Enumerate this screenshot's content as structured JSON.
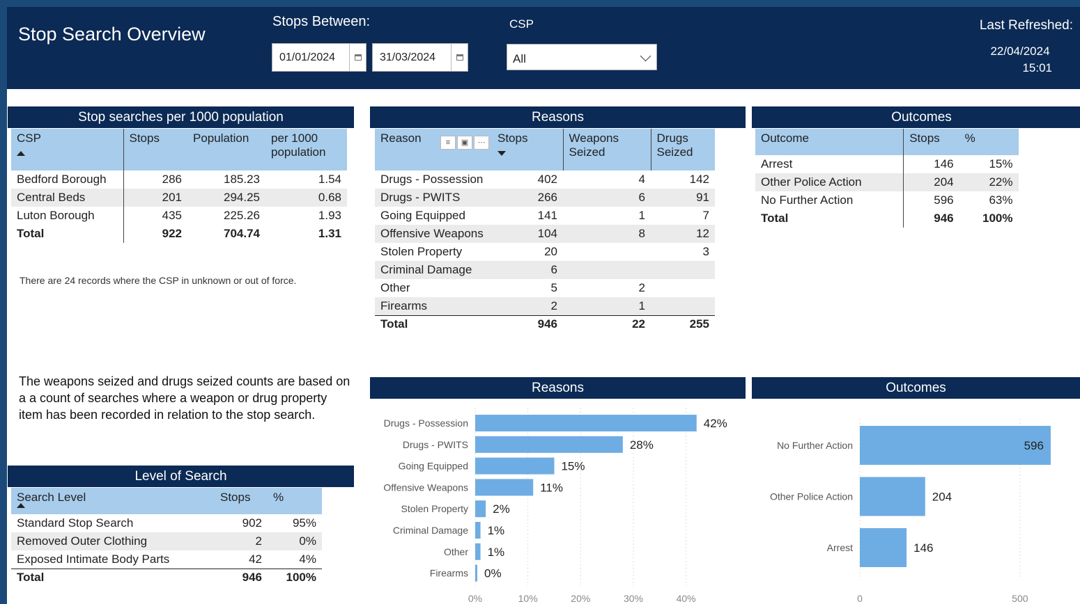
{
  "header": {
    "title": "Stop Search Overview",
    "stops_between_label": "Stops Between:",
    "date_from": "01/01/2024",
    "date_to": "31/03/2024",
    "csp_label": "CSP",
    "csp_value": "All",
    "last_refreshed_label": "Last Refreshed:",
    "last_refreshed_date": "22/04/2024",
    "last_refreshed_time": "15:01"
  },
  "population_table": {
    "title": "Stop searches per 1000 population",
    "headers": [
      "CSP",
      "Stops",
      "Population",
      "per 1000 population"
    ],
    "rows": [
      [
        "Bedford Borough",
        "286",
        "185.23",
        "1.54"
      ],
      [
        "Central Beds",
        "201",
        "294.25",
        "0.68"
      ],
      [
        "Luton Borough",
        "435",
        "225.26",
        "1.93"
      ]
    ],
    "total": [
      "Total",
      "922",
      "704.74",
      "1.31"
    ],
    "note": "There are 24 records where the CSP in unknown or out of force."
  },
  "weapons_note": "The weapons seized and drugs seized counts are based on a a count of searches where a weapon or drug property item has been recorded in relation to the stop search.",
  "reasons_table": {
    "title": "Reasons",
    "headers": [
      "Reason",
      "Stops",
      "Weapons Seized",
      "Drugs Seized"
    ],
    "rows": [
      [
        "Drugs - Possession",
        "402",
        "4",
        "142"
      ],
      [
        "Drugs - PWITS",
        "266",
        "6",
        "91"
      ],
      [
        "Going Equipped",
        "141",
        "1",
        "7"
      ],
      [
        "Offensive Weapons",
        "104",
        "8",
        "12"
      ],
      [
        "Stolen Property",
        "20",
        "",
        "3"
      ],
      [
        "Criminal Damage",
        "6",
        "",
        ""
      ],
      [
        "Other",
        "5",
        "2",
        ""
      ],
      [
        "Firearms",
        "2",
        "1",
        ""
      ]
    ],
    "total": [
      "Total",
      "946",
      "22",
      "255"
    ],
    "icons": [
      "filter-icon",
      "expand-icon",
      "more-options-icon"
    ]
  },
  "outcomes_table": {
    "title": "Outcomes",
    "headers": [
      "Outcome",
      "Stops",
      "%"
    ],
    "rows": [
      [
        "Arrest",
        "146",
        "15%"
      ],
      [
        "Other Police Action",
        "204",
        "22%"
      ],
      [
        "No Further Action",
        "596",
        "63%"
      ]
    ],
    "total": [
      "Total",
      "946",
      "100%"
    ]
  },
  "level_table": {
    "title": "Level of Search",
    "headers": [
      "Search Level",
      "Stops",
      "%"
    ],
    "rows": [
      [
        "Standard Stop Search",
        "902",
        "95%"
      ],
      [
        "Removed Outer Clothing",
        "2",
        "0%"
      ],
      [
        "Exposed Intimate Body Parts",
        "42",
        "4%"
      ]
    ],
    "total": [
      "Total",
      "946",
      "100%"
    ]
  },
  "colors": {
    "header_bg": "#0b2a55",
    "table_header_bg": "#a7ccec",
    "bar": "#6eade3"
  },
  "chart_data": [
    {
      "type": "bar",
      "orientation": "horizontal",
      "title": "Reasons",
      "categories": [
        "Drugs - Possession",
        "Drugs - PWITS",
        "Going Equipped",
        "Offensive Weapons",
        "Stolen Property",
        "Criminal Damage",
        "Other",
        "Firearms"
      ],
      "values": [
        42,
        28,
        15,
        11,
        2,
        1,
        1,
        0
      ],
      "data_labels": [
        "42%",
        "28%",
        "15%",
        "11%",
        "2%",
        "1%",
        "1%",
        "0%"
      ],
      "xticks": [
        "0%",
        "10%",
        "20%",
        "30%",
        "40%"
      ],
      "xlim": [
        0,
        46
      ],
      "grid": true
    },
    {
      "type": "bar",
      "orientation": "horizontal",
      "title": "Outcomes",
      "categories": [
        "No Further Action",
        "Other Police Action",
        "Arrest"
      ],
      "values": [
        596,
        204,
        146
      ],
      "data_labels": [
        "596",
        "204",
        "146"
      ],
      "xticks": [
        "0",
        "500"
      ],
      "xlim": [
        0,
        620
      ],
      "grid": true
    }
  ]
}
